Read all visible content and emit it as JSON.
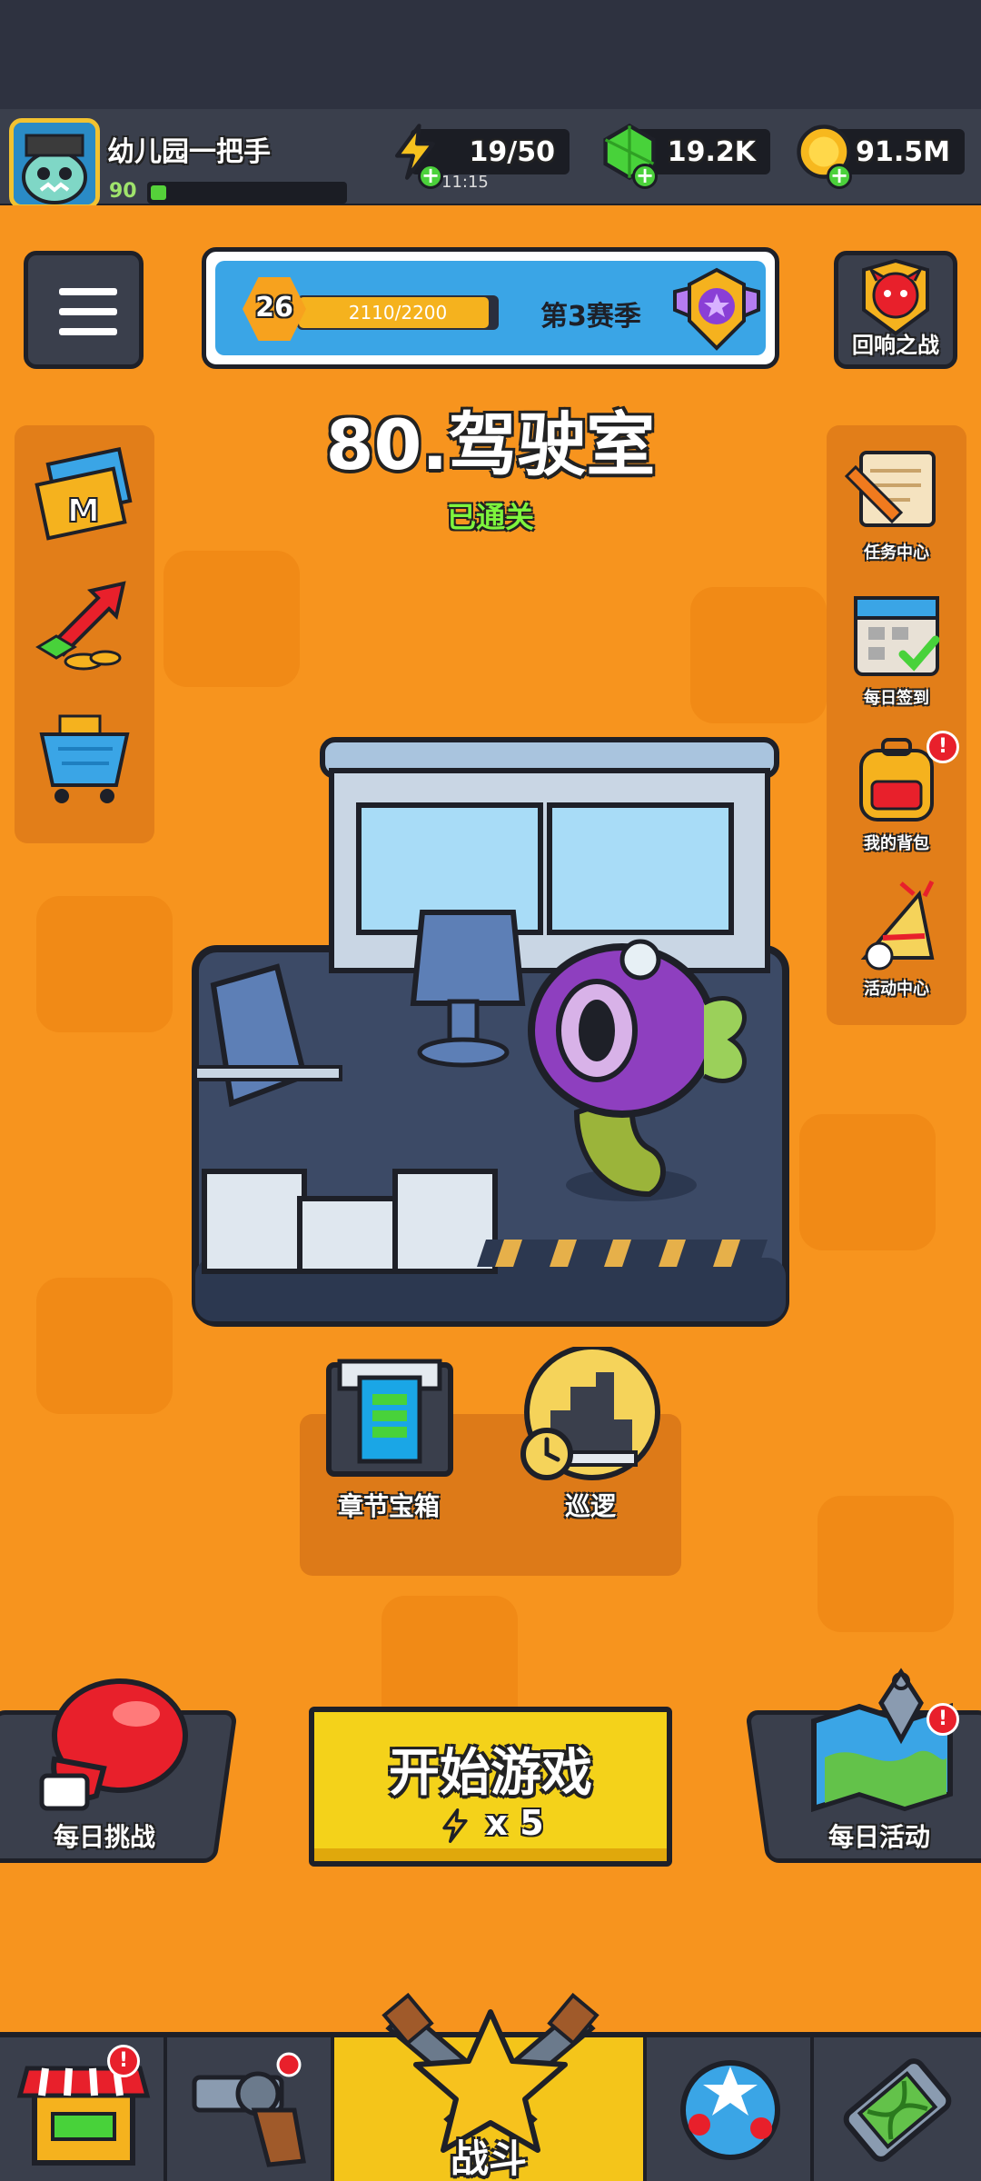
{
  "player": {
    "name": "幼儿园一把手",
    "level": "90",
    "xp_fraction": 0.08
  },
  "resources": {
    "energy": {
      "value": "19/50",
      "timer": "11:15",
      "icon": "lightning-bolt-icon"
    },
    "gems": {
      "value": "19.2K",
      "icon": "green-gem-icon"
    },
    "gold": {
      "value": "91.5M",
      "icon": "gold-coin-icon"
    }
  },
  "season": {
    "level": "26",
    "progress_text": "2110/2200",
    "progress_fraction": 0.959,
    "label": "第3赛季",
    "badge_icon": "purple-star-shield-icon"
  },
  "echo_battle": {
    "label": "回响之战",
    "icon": "red-devil-icon"
  },
  "stage": {
    "title": "80.驾驶室",
    "status": "已通关"
  },
  "left_rail": [
    {
      "name": "m-card",
      "icon": "gold-m-card-icon"
    },
    {
      "name": "upgrade",
      "icon": "red-arrow-gems-icon"
    },
    {
      "name": "shop-cart",
      "icon": "blue-cart-gold-icon"
    }
  ],
  "right_rail": [
    {
      "label": "任务中心",
      "icon": "scroll-pencil-icon",
      "badge": ""
    },
    {
      "label": "每日签到",
      "icon": "calendar-check-icon",
      "badge": ""
    },
    {
      "label": "我的背包",
      "icon": "backpack-icon",
      "badge": "!"
    },
    {
      "label": "活动中心",
      "icon": "party-horn-icon",
      "badge": ""
    }
  ],
  "chapter_chest": {
    "label": "章节宝箱"
  },
  "patrol": {
    "label": "巡逻"
  },
  "daily_challenge": {
    "label": "每日挑战",
    "icon": "boxing-glove-icon"
  },
  "daily_activity": {
    "label": "每日活动",
    "icon": "treasure-map-icon",
    "badge": "!"
  },
  "start_game": {
    "label": "开始游戏",
    "cost": "x 5"
  },
  "bottom_nav": [
    {
      "name": "shop",
      "icon": "shop-stall-icon",
      "badge": "!"
    },
    {
      "name": "weapons",
      "icon": "revolver-icon",
      "badge": ""
    },
    {
      "name": "battle",
      "label": "战斗",
      "icon": "star-crossed-swords-icon"
    },
    {
      "name": "talents",
      "icon": "star-ball-icon"
    },
    {
      "name": "evolve",
      "icon": "dna-capsule-icon"
    }
  ],
  "colors": {
    "main_bg": "#f7941e",
    "panel": "#3a3f4c",
    "accent_yellow": "#f4d21a",
    "cleared_green": "#7ef53d"
  }
}
